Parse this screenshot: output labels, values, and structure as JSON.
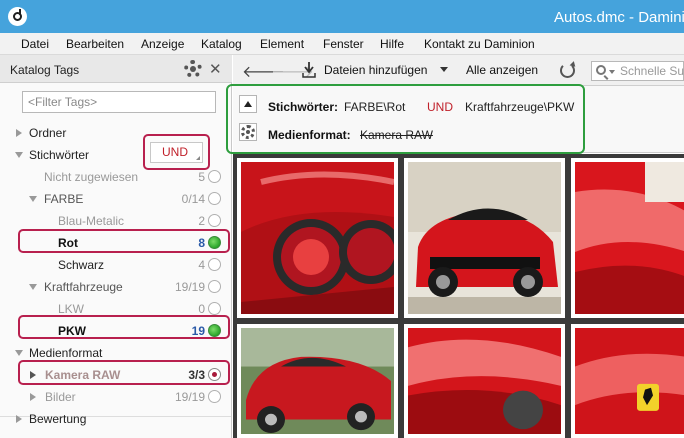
{
  "window": {
    "title": "Autos.dmc - Daminion"
  },
  "menu": [
    "Datei",
    "Bearbeiten",
    "Anzeige",
    "Katalog",
    "Element",
    "Fenster",
    "Hilfe",
    "Kontakt zu Daminion"
  ],
  "sidebar": {
    "title": "Katalog Tags",
    "filter_placeholder": "<Filter Tags>",
    "und_label": "UND",
    "rows": [
      {
        "label": "Ordner",
        "count": ""
      },
      {
        "label": "Stichwörter",
        "count": ""
      },
      {
        "label": "Nicht zugewiesen",
        "count": "5"
      },
      {
        "label": "FARBE",
        "count": "0/14"
      },
      {
        "label": "Blau-Metalic",
        "count": "2"
      },
      {
        "label": "Rot",
        "count": "8"
      },
      {
        "label": "Schwarz",
        "count": "4"
      },
      {
        "label": "Kraftfahrzeuge",
        "count": "19/19"
      },
      {
        "label": "LKW",
        "count": "0"
      },
      {
        "label": "PKW",
        "count": "19"
      },
      {
        "label": "Medienformat",
        "count": ""
      },
      {
        "label": "Kamera RAW",
        "count": "3/3"
      },
      {
        "label": "Bilder",
        "count": "19/19"
      },
      {
        "label": "Bewertung",
        "count": ""
      }
    ]
  },
  "toolbar": {
    "add_files": "Dateien hinzufügen",
    "show_all": "Alle anzeigen",
    "search_placeholder": "Schnelle Suche"
  },
  "filter_panel": {
    "keywords_label": "Stichwörter:",
    "keyword_1": "FARBE\\Rot",
    "operator": "UND",
    "keyword_2": "Kraftfahrzeuge\\PKW",
    "media_label": "Medienformat:",
    "media_value": "Kamera RAW"
  },
  "colors": {
    "titlebar": "#45a3dc",
    "highlight_red": "#b8204e",
    "highlight_green": "#2e9e3e",
    "operator_red": "#c0202a"
  }
}
